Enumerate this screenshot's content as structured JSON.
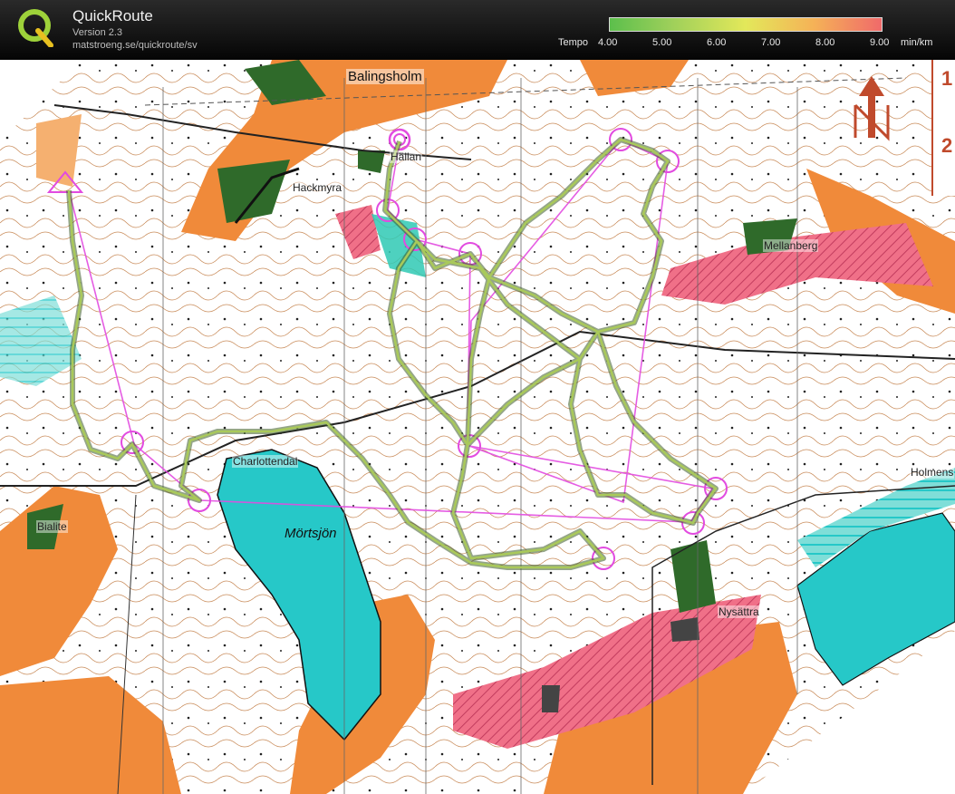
{
  "app": {
    "title": "QuickRoute",
    "version": "Version 2.3",
    "url": "matstroeng.se/quickroute/sv",
    "logo_letter": "Q"
  },
  "tempo": {
    "label": "Tempo",
    "ticks": [
      "4.00",
      "5.00",
      "6.00",
      "7.00",
      "8.00",
      "9.00"
    ],
    "unit": "min/km",
    "colors": {
      "slow": "#f06a6a",
      "mid": "#e3e85a",
      "fast": "#5cbf4c"
    }
  },
  "map": {
    "places": {
      "balingsholm": "Balingsholm",
      "hackmyra": "Hackmyra",
      "hallan": "Hällan",
      "mellanberg": "Mellanberg",
      "charlottendal": "Charlottendal",
      "bialite": "Bialite",
      "nysattra": "Nysättra",
      "holmen": "Holmens"
    },
    "lake": "Mörtsjön",
    "legend_numbers": [
      "1",
      "2"
    ],
    "colors": {
      "open": "#f08a3a",
      "forest_dense": "#2f6a2a",
      "water": "#26c8c8",
      "urban": "#f07088",
      "course": "#e24be0",
      "contour": "#b8703c",
      "route": "#7aa04a"
    },
    "north_arrow": "north-arrow"
  }
}
